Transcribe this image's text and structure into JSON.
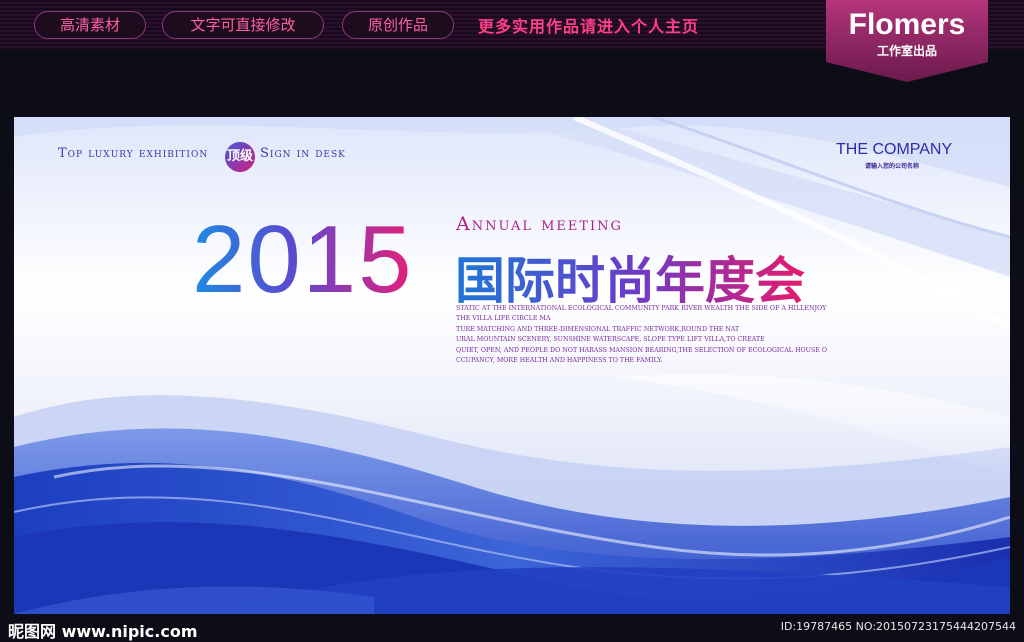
{
  "topbar": {
    "pills": [
      "高清素材",
      "文字可直接修改",
      "原创作品"
    ],
    "note": "更多实用作品请进入个人主页"
  },
  "brand": {
    "name": "Flomers",
    "subtitle": "工作室出品"
  },
  "banner": {
    "tag_left": "Top luxury exhibition",
    "badge": "顶级",
    "tag_right": "Sign in desk",
    "company": "THE COMPANY",
    "company_sub": "请输入您的公司名称",
    "year": "2015",
    "annual": "Annual meeting",
    "title_cn": "国际时尚年度会",
    "paragraph": [
      "STATIC AT THE INTERNATIONAL ECOLOGICAL COMMUNITY PARK RIVER WEALTH THE SIDE OF A HILLENJOY",
      "THE VILLA LIFE CIRCLE MA",
      "TURE MATCHING AND THREE-DIMENSIONAL TRAFFIC NETWORK,ROUND THE NAT",
      "URAL MOUNTAIN SCENERY, SUNSHINE WATERSCAPE, SLOPE TYPE LIFT VILLA,TO CREATE",
      "QUIET, OPEN, AND PEOPLE DO NOT HARASS MANSION BEARING,THE SELECTION OF ECOLOGICAL HOUSE O",
      "CCUPANCY, MORE HEALTH AND HAPPINESS TO THE FAMILY."
    ]
  },
  "footer": {
    "logo": "昵图网 www.nipic.com",
    "id_text": "ID:19787465 NO:20150723175444207544"
  }
}
